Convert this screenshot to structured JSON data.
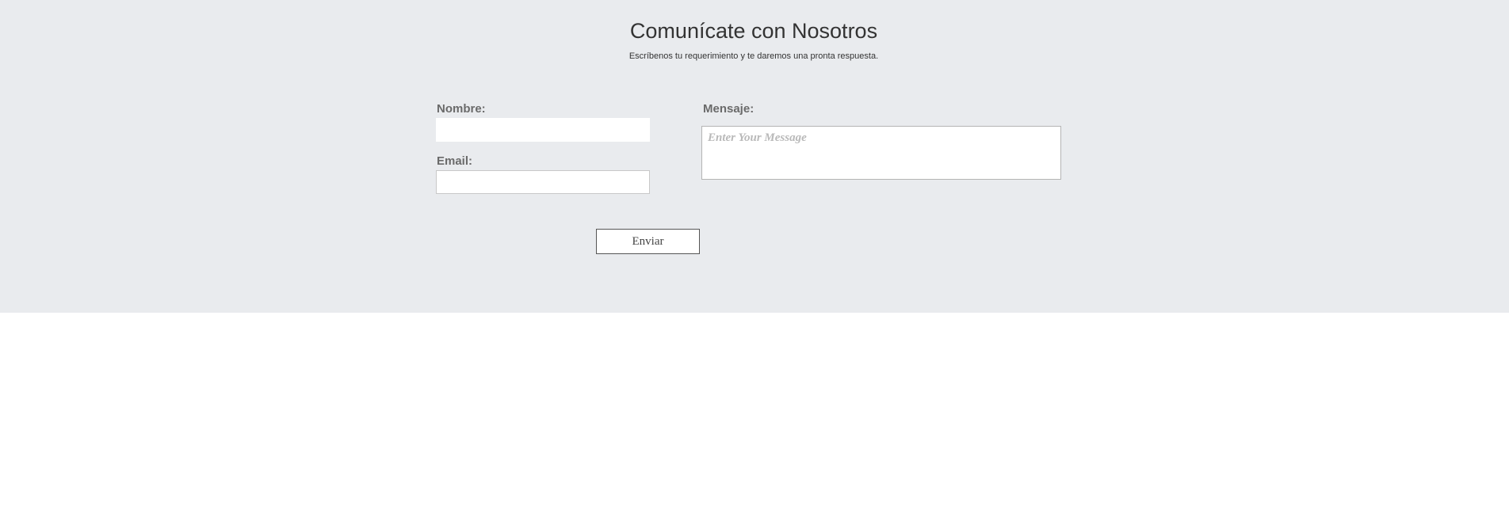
{
  "contact": {
    "title": "Comunícate con Nosotros",
    "subtitle": "Escríbenos tu requerimiento y te daremos una pronta respuesta.",
    "name_label": "Nombre:",
    "name_value": "",
    "email_label": "Email:",
    "email_value": "",
    "message_label": "Mensaje:",
    "message_placeholder": "Enter Your Message",
    "submit_label": "Enviar"
  },
  "colors": {
    "section_background": "#e9ebee",
    "page_background": "#ffffff",
    "label_text": "#6a6a6a",
    "heading_text": "#333333"
  }
}
